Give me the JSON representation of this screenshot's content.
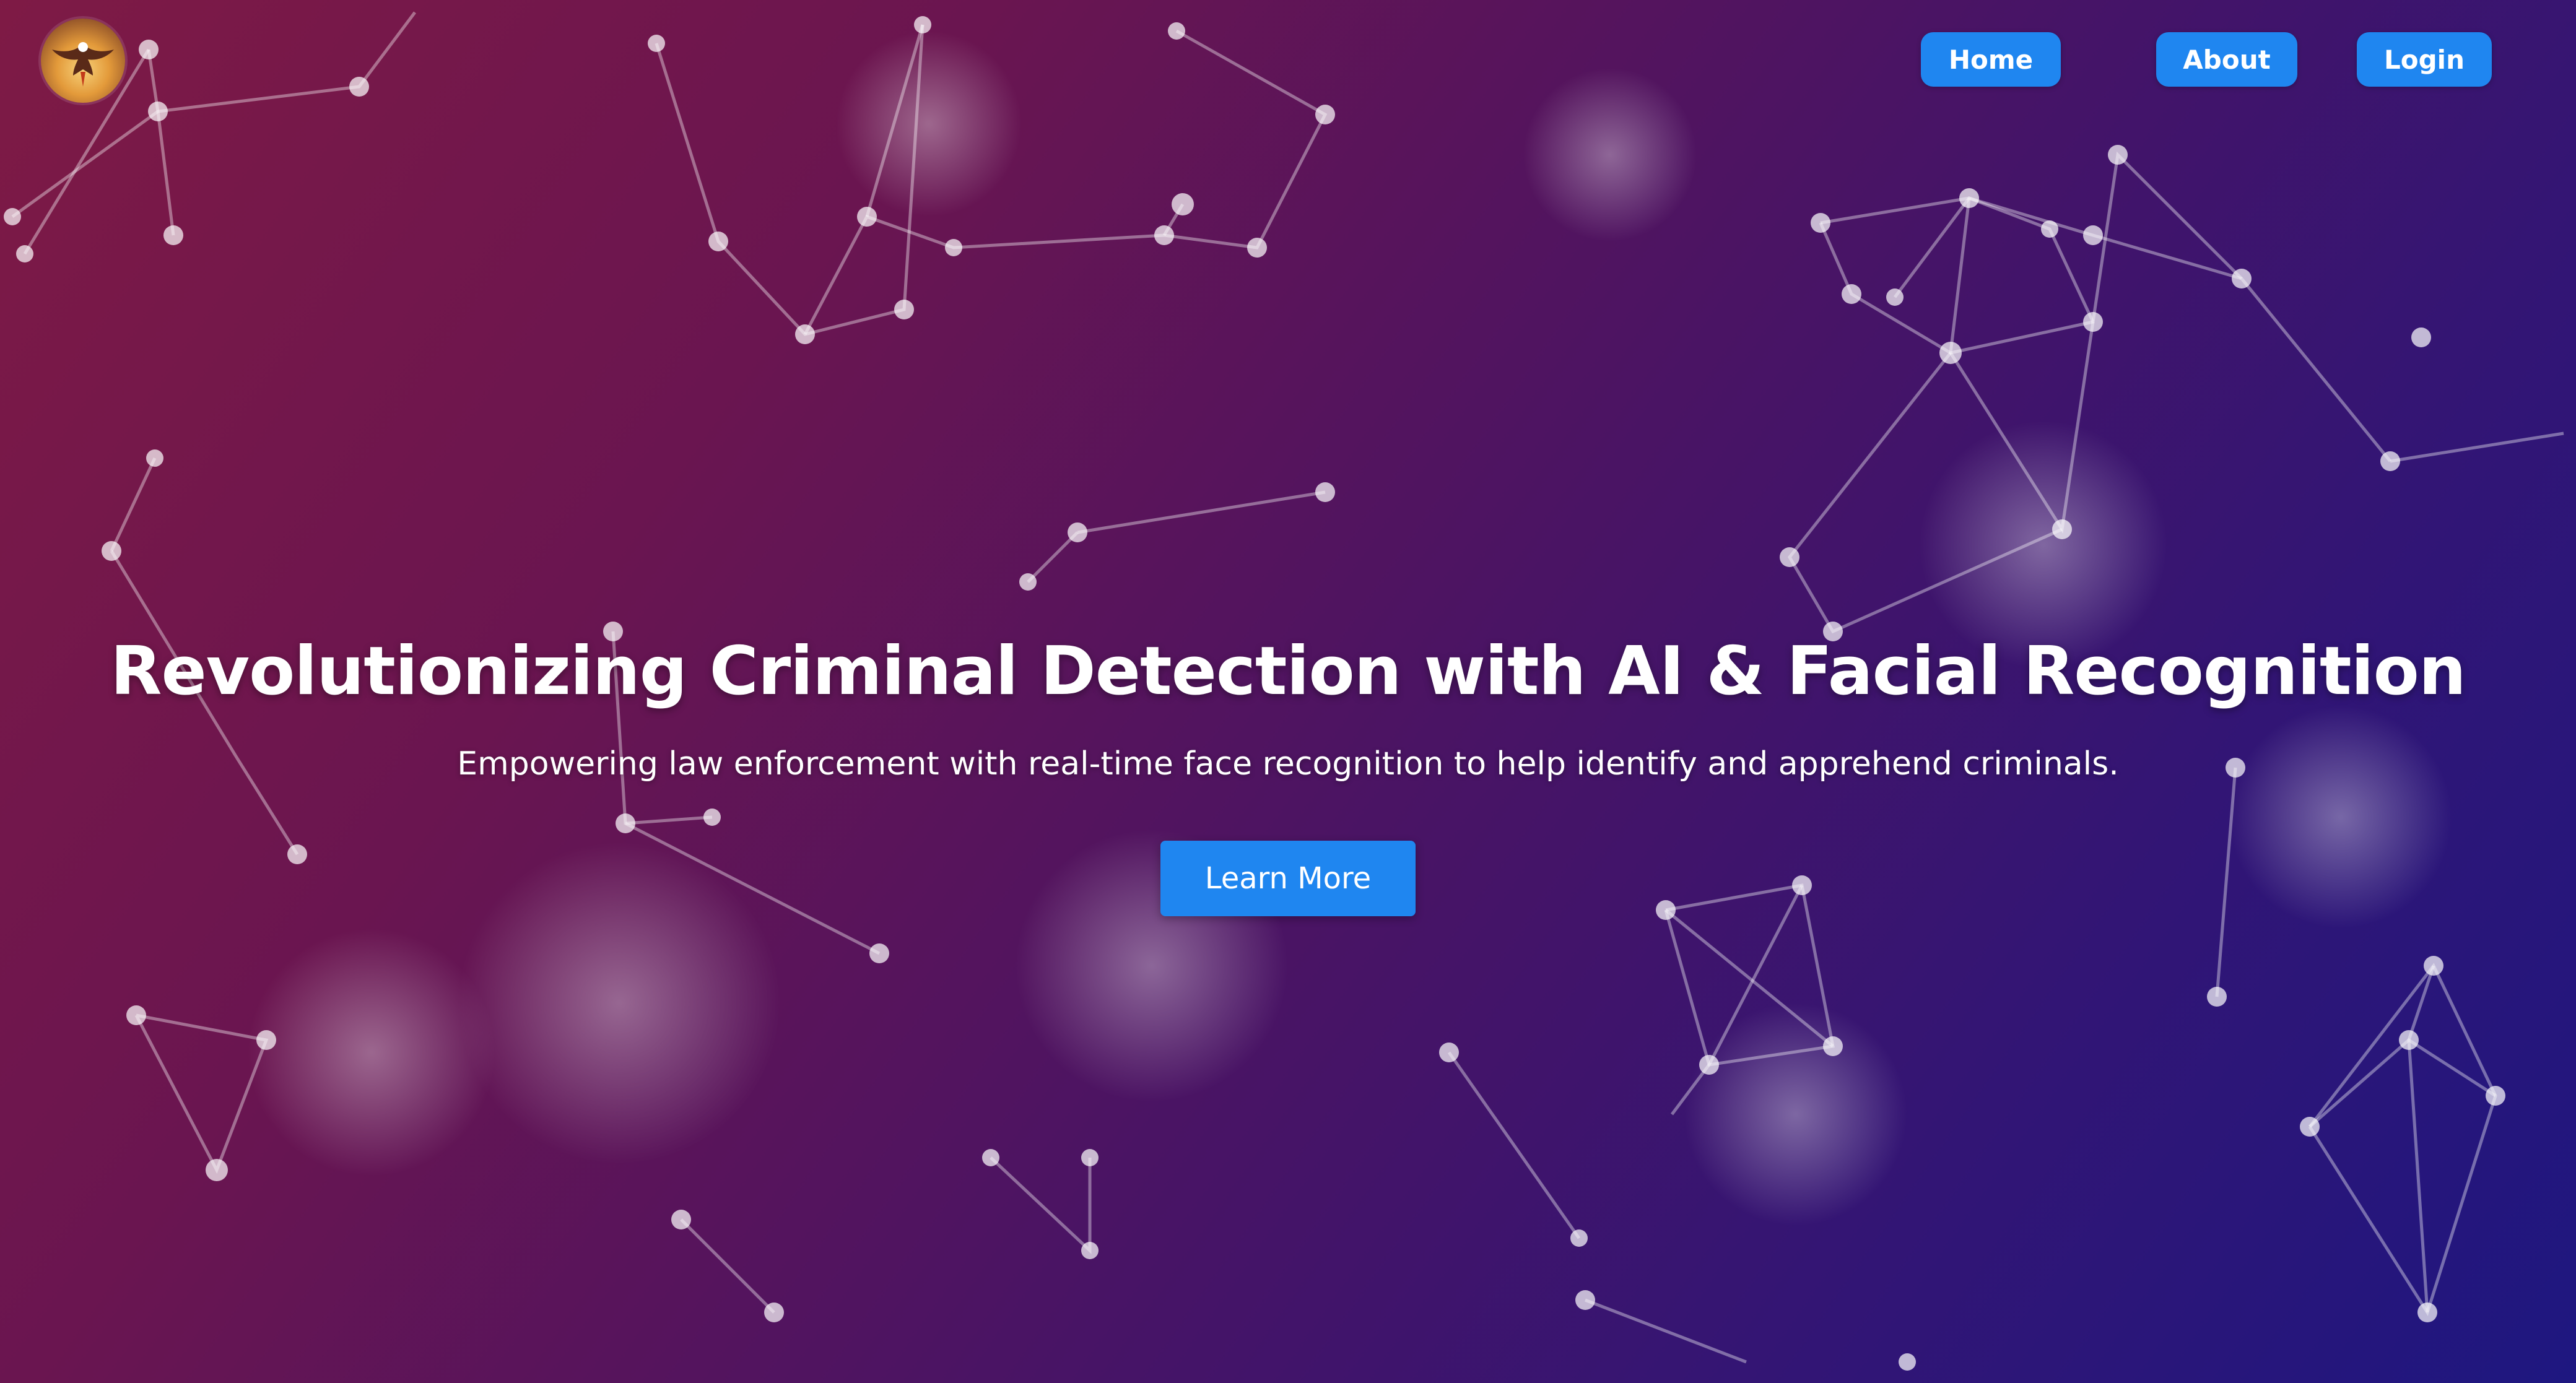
{
  "nav": {
    "logo_icon": "eagle-logo-icon",
    "items": [
      {
        "label": "Home"
      },
      {
        "label": "About"
      },
      {
        "label": "Login"
      }
    ]
  },
  "hero": {
    "title": "Revolutionizing Criminal Detection with AI & Facial Recognition",
    "subtitle": "Empowering law enforcement with real-time face recognition to help identify and apprehend criminals.",
    "cta_label": "Learn More"
  },
  "theme": {
    "accent": "#1f86f0",
    "background_start": "#7e1a45",
    "background_end": "#1e1780",
    "text": "#ffffff"
  }
}
